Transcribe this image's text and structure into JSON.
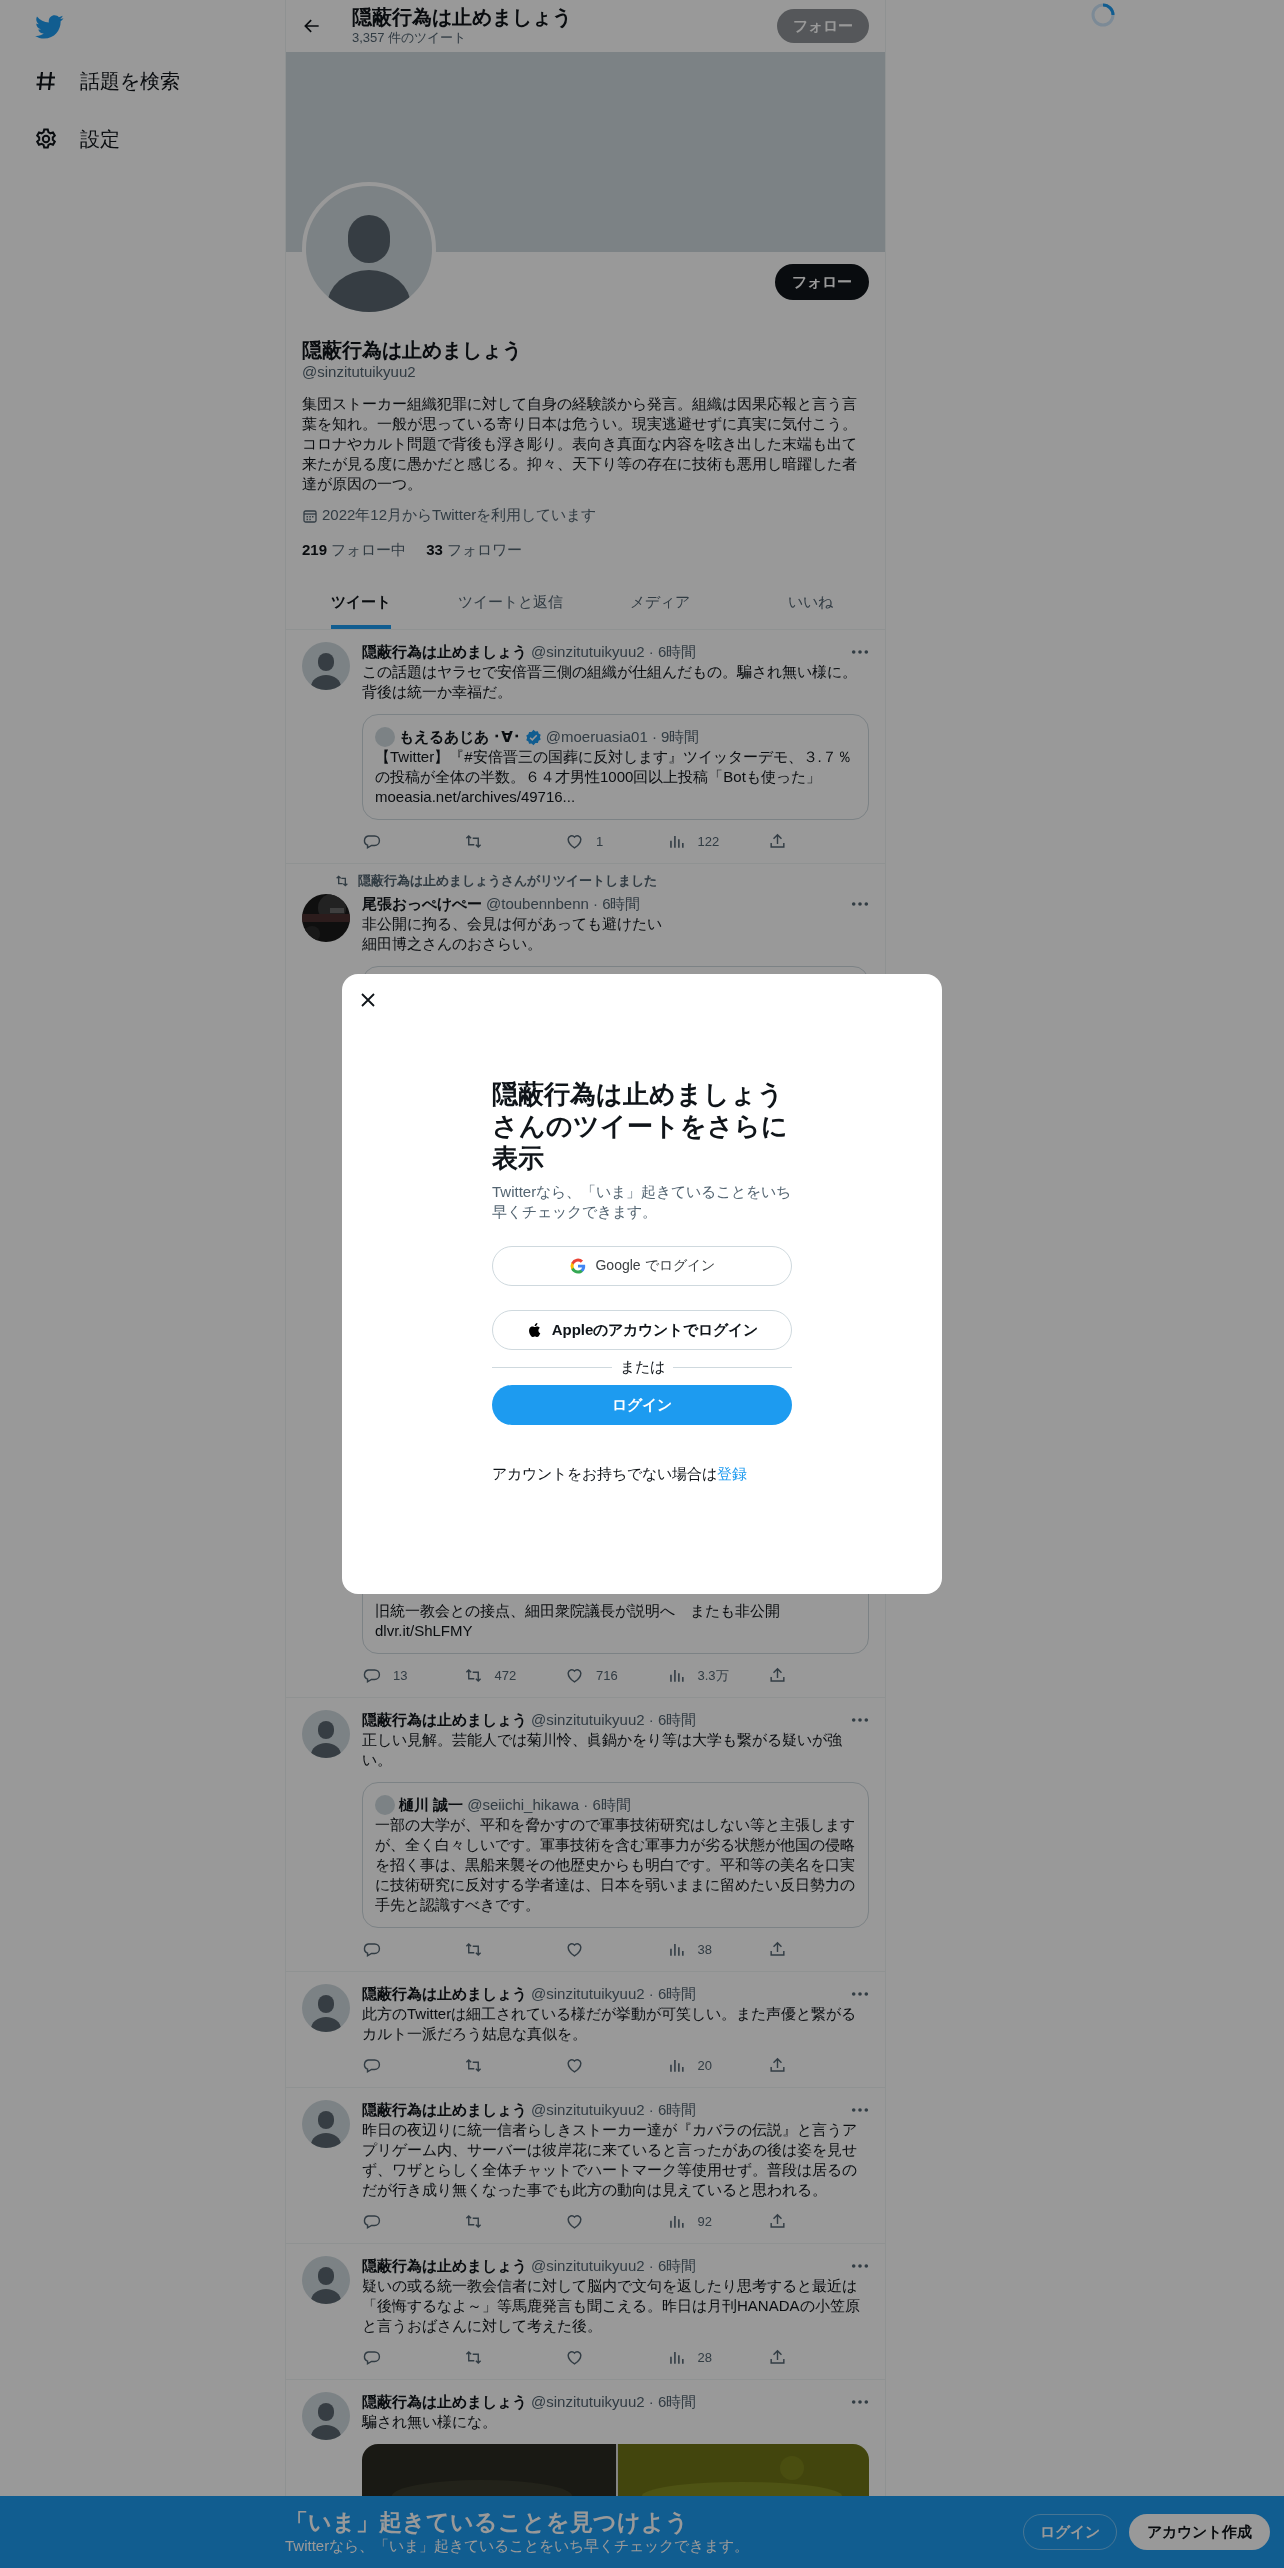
{
  "sidebar": {
    "items": [
      {
        "kind": "hash",
        "label": "話題を検索"
      },
      {
        "kind": "gear",
        "label": "設定"
      }
    ]
  },
  "header": {
    "title": "隠蔽行為は止めましょう",
    "tweet_count": "3,357 件のツイート",
    "follow_button": "フォロー"
  },
  "profile": {
    "follow_button": "フォロー",
    "name": "隠蔽行為は止めましょう",
    "handle": "@sinzitutuikyuu2",
    "bio": "集団ストーカー組織犯罪に対して自身の経験談から発言。組織は因果応報と言う言葉を知れ。一般が思っている寄り日本は危うい。現実逃避せずに真実に気付こう。コロナやカルト問題で背後も浮き彫り。表向き真面な内容を呟き出した末端も出て来たが見る度に愚かだと感じる。抑々、天下り等の存在に技術も悪用し暗躍した者達が原因の一つ。",
    "joined": "2022年12月からTwitterを利用しています",
    "following_count": "219",
    "following_label": "フォロー中",
    "followers_count": "33",
    "followers_label": "フォロワー"
  },
  "tabs": [
    {
      "label": "ツイート",
      "selected": true
    },
    {
      "label": "ツイートと返信",
      "selected": false
    },
    {
      "label": "メディア",
      "selected": false
    },
    {
      "label": "いいね",
      "selected": false
    }
  ],
  "tweets": [
    {
      "avatar": {
        "kind": "default"
      },
      "name": "隠蔽行為は止めましょう",
      "meta": "@sinzitutuikyuu2 · 6時間",
      "text": "この話題はヤラセで安倍晋三側の組織が仕組んだもの。騙され無い様に。背後は統一か幸福だ。",
      "quote": {
        "name": "もえるあじあ ･∀･",
        "verified": true,
        "meta": "@moeruasia01 · 9時間",
        "text": "【Twitter】『#安倍晋三の国葬に反対します』ツイッターデモ、３.７％の投稿が全体の半数。６４才男性1000回以上投稿「Botも使った」",
        "link": "moeasia.net/archives/49716..."
      },
      "stats": {
        "likes": "1",
        "views": "122"
      }
    },
    {
      "retweeted_by": "隠蔽行為は止めましょうさんがリツイートしました",
      "name": "尾張おっぺけぺー",
      "meta": "@toubennbenn · 6時間",
      "text": [
        "非公開に拘る、会見は何があっても避けたい",
        "細田博之さんのおさらい。"
      ],
      "quote": {
        "text": "旧統一教会との接点、細田衆院議長が説明へ　またも非公開",
        "link": "dlvr.it/ShLFMY"
      },
      "stats": {
        "replies": "13",
        "retweets": "472",
        "likes": "716",
        "views": "3.3万"
      }
    },
    {
      "avatar": {
        "kind": "default"
      },
      "name": "隠蔽行為は止めましょう",
      "meta": "@sinzitutuikyuu2 · 6時間",
      "text": "正しい見解。芸能人では菊川怜、眞鍋かをり等は大学も繋がる疑いが強い。",
      "quote": {
        "name": "樋川 誠一",
        "verified": false,
        "meta": "@seiichi_hikawa · 6時間",
        "text": "一部の大学が、平和を脅かすので軍事技術研究はしない等と主張しますが、全く白々しいです。軍事技術を含む軍事力が劣る状態が他国の侵略を招く事は、黒船来襲その他歴史からも明白です。平和等の美名を口実に技術研究に反対する学者達は、日本を弱いままに留めたい反日勢力の手先と認識すべきです。"
      },
      "stats": {
        "views": "38"
      }
    },
    {
      "avatar": {
        "kind": "default"
      },
      "name": "隠蔽行為は止めましょう",
      "meta": "@sinzitutuikyuu2 · 6時間",
      "text": "此方のTwitterは細工されている様だが挙動が可笑しい。また声優と繋がるカルト一派だろう姑息な真似を。",
      "stats": {
        "views": "20"
      }
    },
    {
      "avatar": {
        "kind": "default"
      },
      "name": "隠蔽行為は止めましょう",
      "meta": "@sinzitutuikyuu2 · 6時間",
      "text": "昨日の夜辺りに統一信者らしきストーカー達が『カバラの伝説』と言うアプリゲーム内、サーバーは彼岸花に来ていると言ったがあの後は姿を見せず、ワザとらしく全体チャットでハートマーク等使用せず。普段は居るのだが行き成り無くなった事でも此方の動向は見えていると思われる。",
      "stats": {
        "views": "92"
      }
    },
    {
      "avatar": {
        "kind": "default"
      },
      "name": "隠蔽行為は止めましょう",
      "meta": "@sinzitutuikyuu2 · 6時間",
      "text": "疑いの或る統一教会信者に対して脳内で文句を返したり思考すると最近は「後悔するなよ～」等馬鹿発言も聞こえる。昨日は月刊HANADAの小笠原と言うおばさんに対して考えた後。",
      "stats": {
        "views": "28"
      }
    },
    {
      "avatar": {
        "kind": "default"
      },
      "name": "隠蔽行為は止めましょう",
      "meta": "@sinzitutuikyuu2 · 6時間",
      "text": "騙され無い様にな。"
    }
  ],
  "modal": {
    "title": "隠蔽行為は止めましょうさんのツイートをさらに表示",
    "subtitle": "Twitterなら、「いま」起きていることをいち早くチェックできます。",
    "buttons": [
      {
        "kind": "google",
        "label": "Google でログイン"
      },
      {
        "kind": "apple",
        "label": "Appleのアカウントでログイン"
      }
    ],
    "divider": "または",
    "login_button": "ログイン",
    "signup_prompt": "アカウントをお持ちでない場合は",
    "signup_link": "登録"
  },
  "bottom_bar": {
    "title": "「いま」起きていることを見つけよう",
    "subtitle": "Twitterなら、「いま」起きていることをいち早くチェックできます。",
    "login_button": "ログイン",
    "signup_button": "アカウント作成"
  }
}
